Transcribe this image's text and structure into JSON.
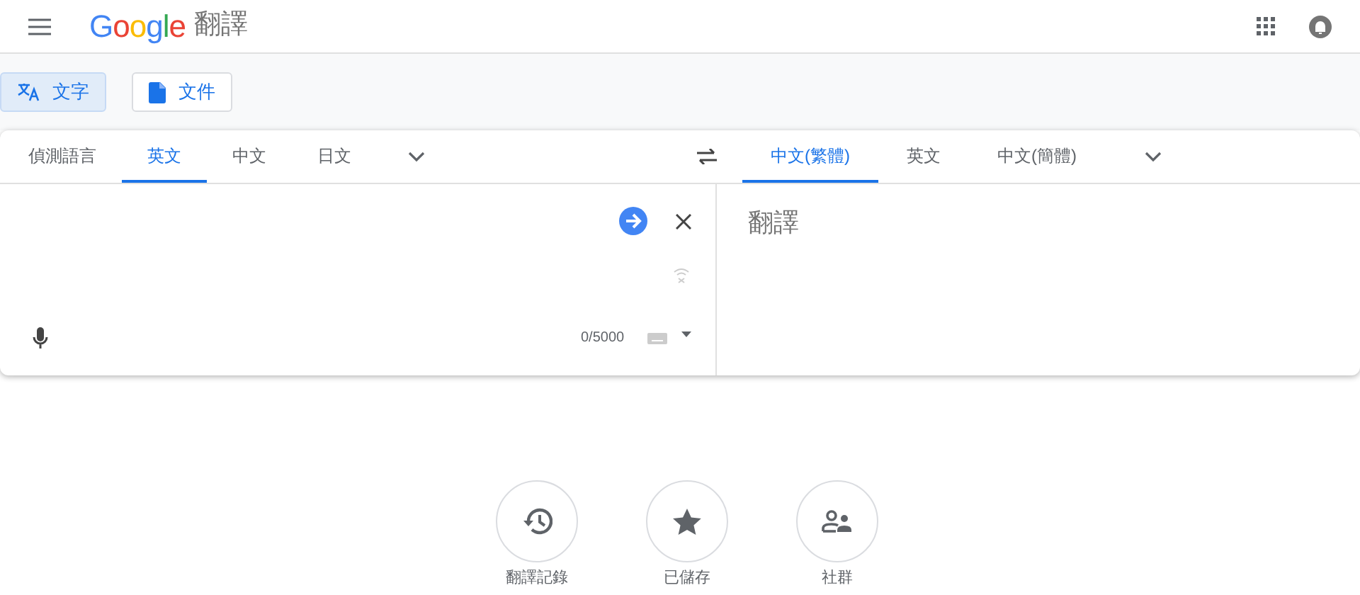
{
  "header": {
    "logo": "Google",
    "product": "翻譯"
  },
  "modes": [
    {
      "label": "文字",
      "kind": "text",
      "selected": true
    },
    {
      "label": "文件",
      "kind": "document",
      "selected": false
    }
  ],
  "source_languages": [
    {
      "label": "偵測語言",
      "selected": false
    },
    {
      "label": "英文",
      "selected": true
    },
    {
      "label": "中文",
      "selected": false
    },
    {
      "label": "日文",
      "selected": false
    }
  ],
  "target_languages": [
    {
      "label": "中文(繁體)",
      "selected": true
    },
    {
      "label": "英文",
      "selected": false
    },
    {
      "label": "中文(簡體)",
      "selected": false
    }
  ],
  "source": {
    "char_count": "0/5000"
  },
  "target": {
    "placeholder": "翻譯"
  },
  "shortcuts": [
    {
      "label": "翻譯記錄",
      "kind": "history"
    },
    {
      "label": "已儲存",
      "kind": "saved"
    },
    {
      "label": "社群",
      "kind": "community"
    }
  ]
}
